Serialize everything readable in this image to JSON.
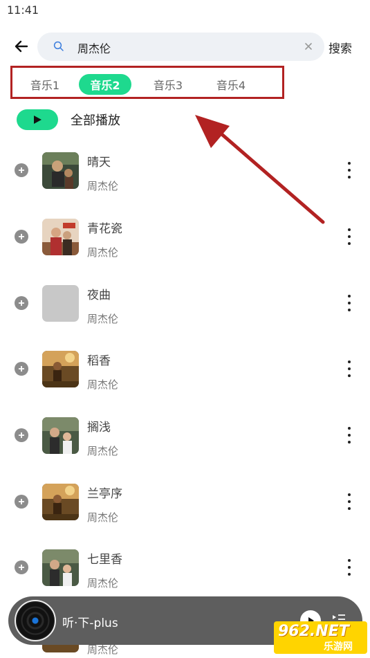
{
  "status_bar": {
    "time": "11:41"
  },
  "header": {
    "search_query": "周杰伦",
    "search_button": "搜索"
  },
  "tabs": [
    {
      "label": "音乐1",
      "active": false
    },
    {
      "label": "音乐2",
      "active": true
    },
    {
      "label": "音乐3",
      "active": false
    },
    {
      "label": "音乐4",
      "active": false
    }
  ],
  "play_all": {
    "label": "全部播放"
  },
  "songs": [
    {
      "title": "晴天",
      "artist": "周杰伦",
      "cover": "cover-photo"
    },
    {
      "title": "青花瓷",
      "artist": "周杰伦",
      "cover": "cover-photo"
    },
    {
      "title": "夜曲",
      "artist": "周杰伦",
      "cover": "cover-placeholder"
    },
    {
      "title": "稻香",
      "artist": "周杰伦",
      "cover": "cover-photo"
    },
    {
      "title": "搁浅",
      "artist": "周杰伦",
      "cover": "cover-photo"
    },
    {
      "title": "兰亭序",
      "artist": "周杰伦",
      "cover": "cover-photo"
    },
    {
      "title": "七里香",
      "artist": "周杰伦",
      "cover": "cover-photo"
    },
    {
      "title": "",
      "artist": "周杰伦",
      "cover": "cover-photo"
    }
  ],
  "player": {
    "title": "听·下-plus"
  },
  "watermark": {
    "main": "962.NET",
    "sub": "乐游网"
  },
  "colors": {
    "accent": "#1ed98e",
    "annotation": "#b22222"
  }
}
